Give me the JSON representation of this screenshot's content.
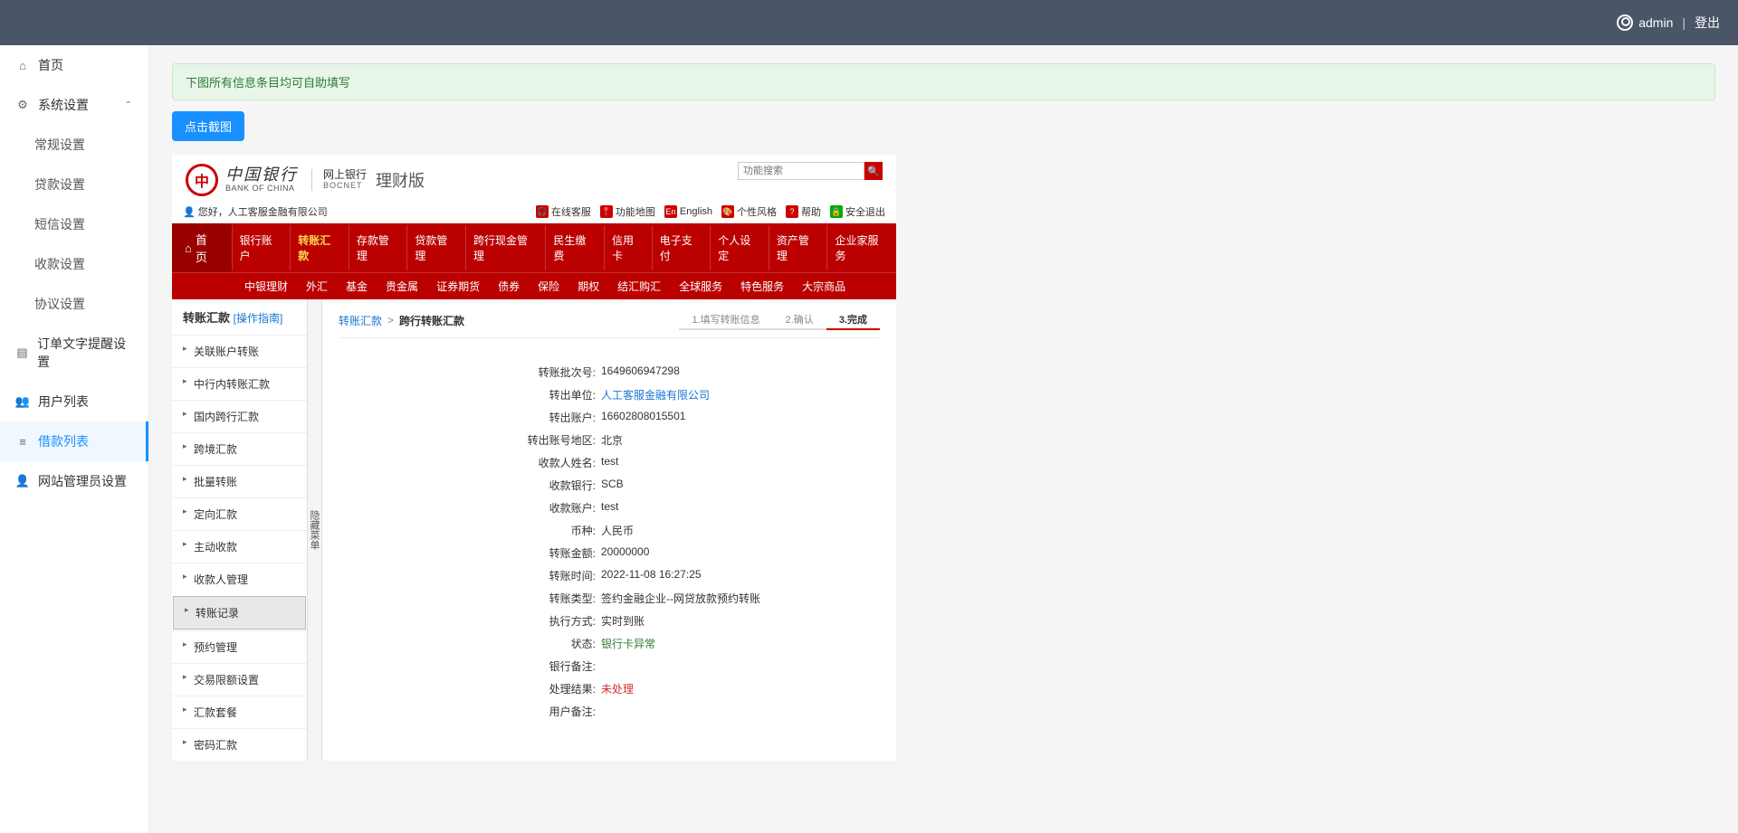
{
  "topbar": {
    "user": "admin",
    "logout": "登出"
  },
  "sidebar": {
    "home": "首页",
    "settings": "系统设置",
    "settings_children": [
      "常规设置",
      "贷款设置",
      "短信设置",
      "收款设置",
      "协议设置"
    ],
    "order_text": "订单文字提醒设置",
    "users": "用户列表",
    "loans": "借款列表",
    "admins": "网站管理员设置"
  },
  "alert": "下图所有信息条目均可自助填写",
  "screenshot_btn": "点击截图",
  "bank": {
    "logo_cn": "中国银行",
    "logo_en": "BANK OF CHINA",
    "sub_cn": "网上银行",
    "sub_en": "BOCNET",
    "version": "理财版",
    "search_placeholder": "功能搜索",
    "greeting_prefix": "您好，",
    "greeting_name": "人工客服金融有限公司",
    "toolbar": {
      "contact": "在线客服",
      "map": "功能地图",
      "english": "English",
      "style": "个性风格",
      "help": "帮助",
      "exit": "安全退出"
    },
    "nav_home": "首页",
    "nav_row1": [
      "银行账户",
      "转账汇款",
      "存款管理",
      "贷款管理",
      "跨行现金管理",
      "民生缴费",
      "信用卡",
      "电子支付",
      "个人设定",
      "资产管理",
      "企业家服务"
    ],
    "nav_hl_index": 1,
    "nav_row2": [
      "中银理财",
      "外汇",
      "基金",
      "贵金属",
      "证券期货",
      "债券",
      "保险",
      "期权",
      "结汇购汇",
      "全球服务",
      "特色服务",
      "大宗商品"
    ],
    "side_title": "转账汇款",
    "side_guide": "[操作指南]",
    "side_items": [
      "关联账户转账",
      "中行内转账汇款",
      "国内跨行汇款",
      "跨境汇款",
      "批量转账",
      "定向汇款",
      "主动收款",
      "收款人管理",
      "转账记录",
      "预约管理",
      "交易限额设置",
      "汇款套餐",
      "密码汇款"
    ],
    "side_active_index": 8,
    "hide_menu": "隐藏菜单",
    "crumb1": "转账汇款",
    "crumb2": "跨行转账汇款",
    "steps": [
      "1.填写转账信息",
      "2.确认",
      "3.完成"
    ],
    "step_active": 2,
    "details": [
      {
        "label": "转账批次号:",
        "value": "1649606947298"
      },
      {
        "label": "转出单位:",
        "value": "人工客服金融有限公司",
        "cls": "blue"
      },
      {
        "label": "转出账户:",
        "value": "16602808015501"
      },
      {
        "label": "转出账号地区:",
        "value": "北京"
      },
      {
        "label": "收款人姓名:",
        "value": "test"
      },
      {
        "label": "收款银行:",
        "value": "SCB"
      },
      {
        "label": "收款账户:",
        "value": "test"
      },
      {
        "label": "币种:",
        "value": "人民币"
      },
      {
        "label": "转账金额:",
        "value": "20000000"
      },
      {
        "label": "转账时间:",
        "value": "2022-11-08 16:27:25"
      },
      {
        "label": "转账类型:",
        "value": "签约金融企业--网贷放款预约转账"
      },
      {
        "label": "执行方式:",
        "value": "实时到账"
      },
      {
        "label": "状态:",
        "value": "银行卡异常",
        "cls": "green"
      },
      {
        "label": "银行备注:",
        "value": ""
      },
      {
        "label": "处理结果:",
        "value": "未处理",
        "cls": "red"
      },
      {
        "label": "用户备注:",
        "value": ""
      }
    ]
  }
}
